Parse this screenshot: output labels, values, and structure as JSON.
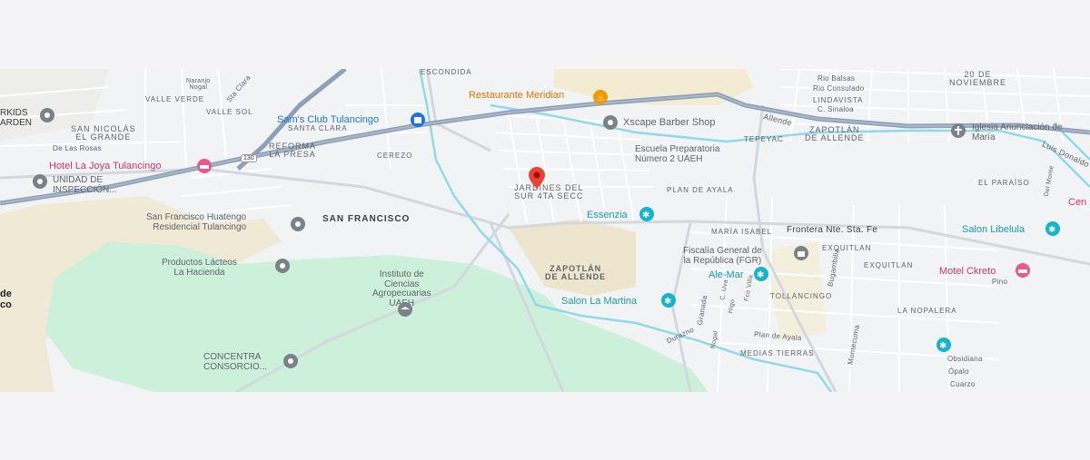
{
  "map": {
    "areas": {
      "san_francisco": "SAN FRANCISCO",
      "zapotlan": "ZAPOTLÁN\nDE ALLENDE"
    },
    "neighborhoods": {
      "escondida": "ESCONDIDA",
      "valle_verde": "VALLE VERDE",
      "valle_sol": "VALLE SOL",
      "san_nicolas": "SAN NICOLÁS\nEL GRANDE",
      "santa_clara": "SANTA CLARA",
      "reforma": "REFORMA\nLA PRESA",
      "cerezo": "CEREZO",
      "jardines": "JARDINES DEL\nSUR 4TA SECC",
      "tepeyac": "TEPEYAC",
      "zapotlan_de_allende": "ZAPOTLÁN\nDE ALLENDE",
      "plan_de_ayala": "PLAN DE AYALA",
      "maria_isabel": "MARÍA ISABEL",
      "exquitlan1": "EXQUITLAN",
      "exquitlan2": "EXQUITLAN",
      "tollancingo": "TOLLANCINGO",
      "la_nopalera": "LA NOPALERA",
      "medias_tierras": "MEDIAS TIERRAS",
      "el_paraiso": "EL PARAÍSO",
      "lindavista": "LINDAVISTA",
      "veinte_nov": "20 DE\nNOVIEMBRE"
    },
    "streets": {
      "rio_balsas": "Rio Balsas",
      "rio_consulado": "Rio Consulado",
      "c_sinaloa": "C. Sinaloa",
      "allende": "Allende",
      "frontera": "Frontera Nte. Sta. Fe",
      "de_las_rosas": "De Las Rosas",
      "plan_de_ayala_st": "Plan de Ayala",
      "durazno": "Durazno",
      "granada": "Granada",
      "montecuma": "Montecuma",
      "bugambilia": "Bugambilia",
      "obsidiana": "Obsidiana",
      "opalo": "Ópalo",
      "cuarzo": "Cuarzo",
      "pino": "Pino",
      "naranjo_nogal": "Naranjo\nNogal",
      "sta_clara": "Sta Clara",
      "c_uva": "C. Uva",
      "higo": "Higo",
      "fresa": "Fco Villa",
      "nogal": "Nogal",
      "luis_donaldo": "Luis Donaldo",
      "del_monte": "Del Monte"
    },
    "route_shield": "130",
    "pois": {
      "restaurante": "Restaurante Meridian",
      "xscape": "Xscape Barber Shop",
      "escuela": "Escuela Preparatoria\nNúmero 2 UAEH",
      "sams": "Sam's Club Tulancingo",
      "hotel_joya": "Hotel La Joya Tulancingo",
      "unidad": "UNIDAD DE\nINSPECCIÓN...",
      "kids": "RKIDS\nARDEN",
      "sf_huatengo": "San Francisco Huatengo\nResidencial Tulancingo",
      "productos": "Productos Lácteos\nLa Hacienda",
      "instituto": "Instituto de\nCiencias\nAgropecuarias\nUAEH",
      "concentra": "CONCENTRA\nCONSORCIO...",
      "essenzia": "Essenzia",
      "salon_martina": "Salon La Martina",
      "fiscalia": "Fiscalía General de\nla República (FGR)",
      "alemar": "Ale-Mar",
      "anunciacion": "Iglesia Anunciación de\nMaría",
      "salon_libelula": "Salon Libelula",
      "motel": "Motel Ckreto",
      "cen": "Cen",
      "left_edge": "de\nco"
    },
    "colors": {
      "road_major": "#8ea0b8",
      "water": "#9be0ef",
      "park": "#c9f0d9",
      "sand": "#f2e9d4",
      "marker": "#ea4335"
    }
  }
}
